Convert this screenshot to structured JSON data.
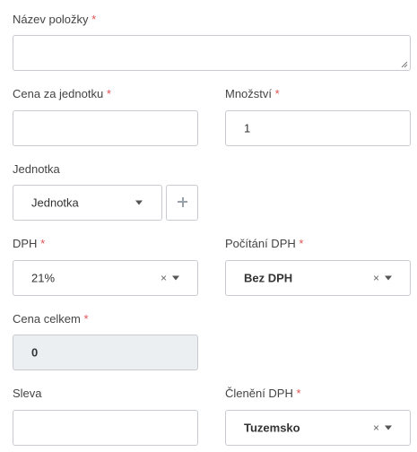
{
  "form": {
    "item_name": {
      "label": "Název položky",
      "required": "*",
      "value": ""
    },
    "unit_price": {
      "label": "Cena za jednotku",
      "required": "*",
      "value": ""
    },
    "quantity": {
      "label": "Množství",
      "required": "*",
      "value": "1"
    },
    "unit": {
      "label": "Jednotka",
      "placeholder": "Jednotka",
      "add_button": "+"
    },
    "vat": {
      "label": "DPH",
      "required": "*",
      "value": "21%",
      "clear": "×"
    },
    "vat_calc": {
      "label": "Počítání DPH",
      "required": "*",
      "value": "Bez DPH",
      "clear": "×"
    },
    "total": {
      "label": "Cena celkem",
      "required": "*",
      "value": "0"
    },
    "discount": {
      "label": "Sleva",
      "value": ""
    },
    "vat_breakdown": {
      "label": "Členění DPH",
      "required": "*",
      "value": "Tuzemsko",
      "clear": "×"
    }
  },
  "colors": {
    "required": "#e05252",
    "border": "#c8ccd0",
    "disabled_bg": "#eceff2"
  },
  "icons": [
    "chevron-down-icon",
    "clear-icon",
    "plus-icon",
    "resize-grip-icon"
  ]
}
